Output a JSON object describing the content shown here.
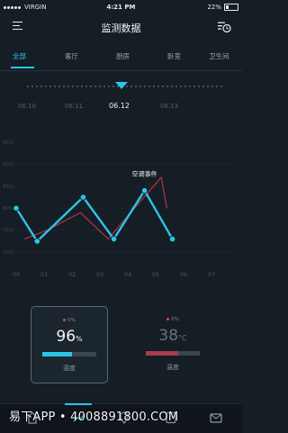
{
  "status_bar": {
    "carrier": "VIRGIN",
    "time": "4:21 PM",
    "battery": "22%"
  },
  "header": {
    "title": "监测数据",
    "menu_icon": "menu-icon",
    "history_icon": "history-icon"
  },
  "tabs": [
    {
      "label": "全部",
      "active": true
    },
    {
      "label": "客厅",
      "active": false
    },
    {
      "label": "厨房",
      "active": false
    },
    {
      "label": "卧室",
      "active": false
    },
    {
      "label": "卫生间",
      "active": false
    }
  ],
  "dates": [
    {
      "label": "06.10",
      "selected": false
    },
    {
      "label": "06.11",
      "selected": false
    },
    {
      "label": "06.12",
      "selected": true
    },
    {
      "label": "06.13",
      "selected": false
    }
  ],
  "chart_data": {
    "type": "line",
    "x": [
      "00",
      "01",
      "02",
      "03",
      "04",
      "05",
      "06",
      "07"
    ],
    "y_ticks": [
      "70%",
      "75%",
      "80%",
      "85%",
      "90%",
      "95%"
    ],
    "ylim": [
      68,
      97
    ],
    "series": [
      {
        "color": "#2bc5e8",
        "x": [
          0,
          0.75,
          2.4,
          3.5,
          4.6,
          5.6
        ],
        "values": [
          80,
          72.5,
          82.5,
          73,
          84,
          73
        ]
      },
      {
        "color": "#a83344",
        "x": [
          0.3,
          1.1,
          2.3,
          3.3,
          4.1,
          5.2,
          5.4
        ],
        "values": [
          73,
          75,
          79,
          73,
          79,
          87,
          80
        ]
      }
    ],
    "annotations": [
      {
        "label": "空调事件",
        "x": 4.6,
        "y": 84
      }
    ]
  },
  "cards": {
    "humidity": {
      "small": "0%",
      "value": "96",
      "unit": "%",
      "label": "湿度",
      "fraction": 0.55,
      "bar_color": "#2bc5e8",
      "dot_color": "#e8404f",
      "selected": true
    },
    "temperature": {
      "small": "0%",
      "value": "38",
      "unit": "°C",
      "label": "温度",
      "fraction": 0.6,
      "bar_color": "#a83c4a",
      "dot_color": "#e8404f",
      "selected": false
    }
  },
  "nav": {
    "icons": [
      "home-icon",
      "chart-icon",
      "location-icon",
      "device-icon",
      "message-icon"
    ]
  },
  "watermark": "易下APP • 4008891800.COM"
}
